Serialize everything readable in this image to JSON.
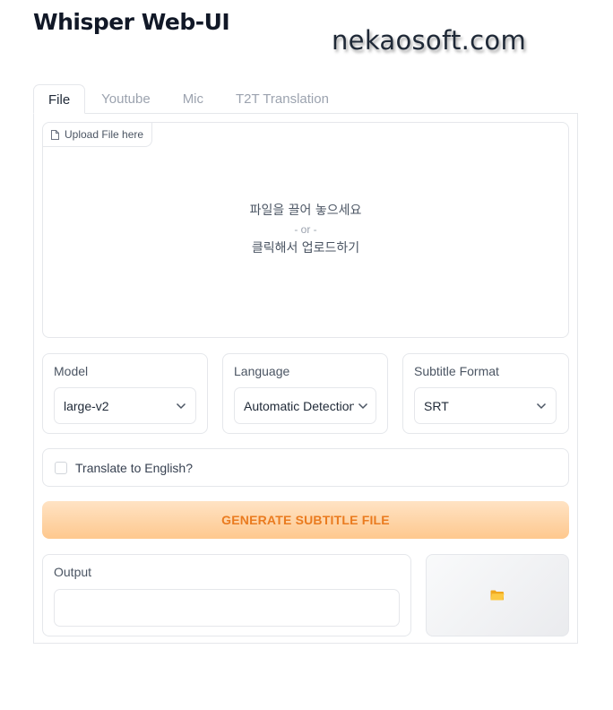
{
  "app": {
    "title": "Whisper Web-UI",
    "watermark": "nekaosoft.com"
  },
  "tabs": [
    {
      "label": "File",
      "active": true
    },
    {
      "label": "Youtube"
    },
    {
      "label": "Mic"
    },
    {
      "label": "T2T Translation"
    }
  ],
  "upload": {
    "label": "Upload File here",
    "drop_text": "파일을 끌어 놓으세요",
    "or_text": "- or -",
    "click_text": "클릭해서 업로드하기"
  },
  "model": {
    "label": "Model",
    "value": "large-v2"
  },
  "language": {
    "label": "Language",
    "value": "Automatic Detection"
  },
  "subtitle_format": {
    "label": "Subtitle Format",
    "value": "SRT"
  },
  "translate": {
    "label": "Translate to English?",
    "checked": false
  },
  "generate": {
    "label": "GENERATE SUBTITLE FILE"
  },
  "output": {
    "label": "Output",
    "value": ""
  },
  "icons": {
    "upload": "file-icon",
    "dropdown": "chevron-down-icon",
    "download": "folder-icon"
  },
  "colors": {
    "accent": "#ea7b1f",
    "button_bg_top": "#ffe3c4",
    "button_bg_bottom": "#fec88e",
    "folder": "#f5b324"
  }
}
